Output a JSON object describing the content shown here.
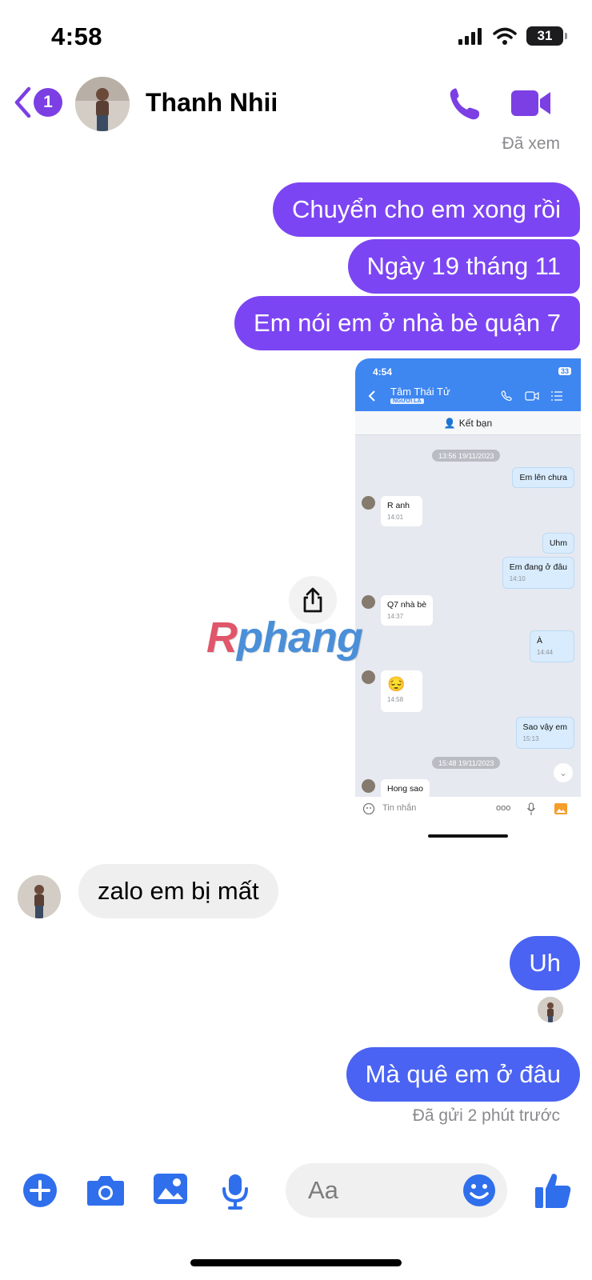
{
  "status_bar": {
    "time": "4:58",
    "battery": "31"
  },
  "header": {
    "back_badge": "1",
    "contact_name": "Thanh Nhii"
  },
  "seen_label": "Đã xem",
  "messages": {
    "m1": "Chuyển cho em xong rồi",
    "m2": "Ngày 19 tháng 11",
    "m3": "Em nói em ở nhà bè quận 7",
    "m4": "zalo em bị mất",
    "m5": "Uh",
    "m6": "Mà quê em ở đâu"
  },
  "sent_label": "Đã gửi 2 phút trước",
  "shared_screenshot": {
    "time": "4:54",
    "battery": "33",
    "contact": "Tâm Thái Tử",
    "tag": "NGƯỜI LẠ",
    "add_friend": "Kết bạn",
    "date1": "13:56 19/11/2023",
    "date2": "15:48 19/11/2023",
    "input_placeholder": "Tin nhắn",
    "msgs": [
      {
        "text": "Em lên chưa",
        "time": ""
      },
      {
        "text": "R anh",
        "time": "14:01"
      },
      {
        "text": "Uhm",
        "time": ""
      },
      {
        "text": "Em đang ở đâu",
        "time": "14:10"
      },
      {
        "text": "Q7 nhà bè",
        "time": "14:37"
      },
      {
        "text": "À",
        "time": "14:44"
      },
      {
        "text": "😔",
        "time": "14:58"
      },
      {
        "text": "Sao vậy em",
        "time": "15:13"
      },
      {
        "text": "Hong sao",
        "time": ""
      }
    ]
  },
  "watermark": {
    "part1": "R",
    "part2": "phang"
  },
  "composer": {
    "placeholder": "Aa"
  },
  "colors": {
    "sent_purple": "#7c45f3",
    "sent_blue": "#4a63f2",
    "accent": "#7b3fe4",
    "icon_blue": "#2f6fec"
  }
}
